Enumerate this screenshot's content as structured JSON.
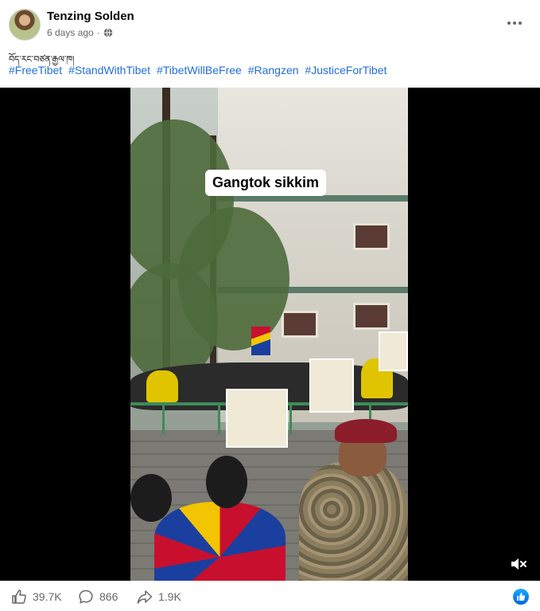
{
  "post": {
    "author": "Tenzing Solden",
    "timestamp": "6 days ago",
    "separator": "·",
    "audience_icon": "globe-icon",
    "more_icon": "more-options-icon",
    "caption_tibetan": "བོད་རང་བཙན་རྒྱལ་ཁ།",
    "hashtags": [
      "#FreeTibet",
      "#StandWithTibet",
      "#TibetWillBeFree",
      "#Rangzen",
      "#JusticeForTibet"
    ]
  },
  "video": {
    "overlay_label": "Gangtok sikkim",
    "mute_icon": "speaker-muted-icon"
  },
  "engagement": {
    "reactions": "39.7K",
    "comments": "866",
    "shares": "1.9K",
    "reaction_icon": "like-icon",
    "comment_icon": "comment-icon",
    "share_icon": "share-icon",
    "badge_icon": "like-badge-icon"
  },
  "colors": {
    "link": "#216fdb",
    "muted_text": "#65676b",
    "like_blue": "#0866ff"
  }
}
